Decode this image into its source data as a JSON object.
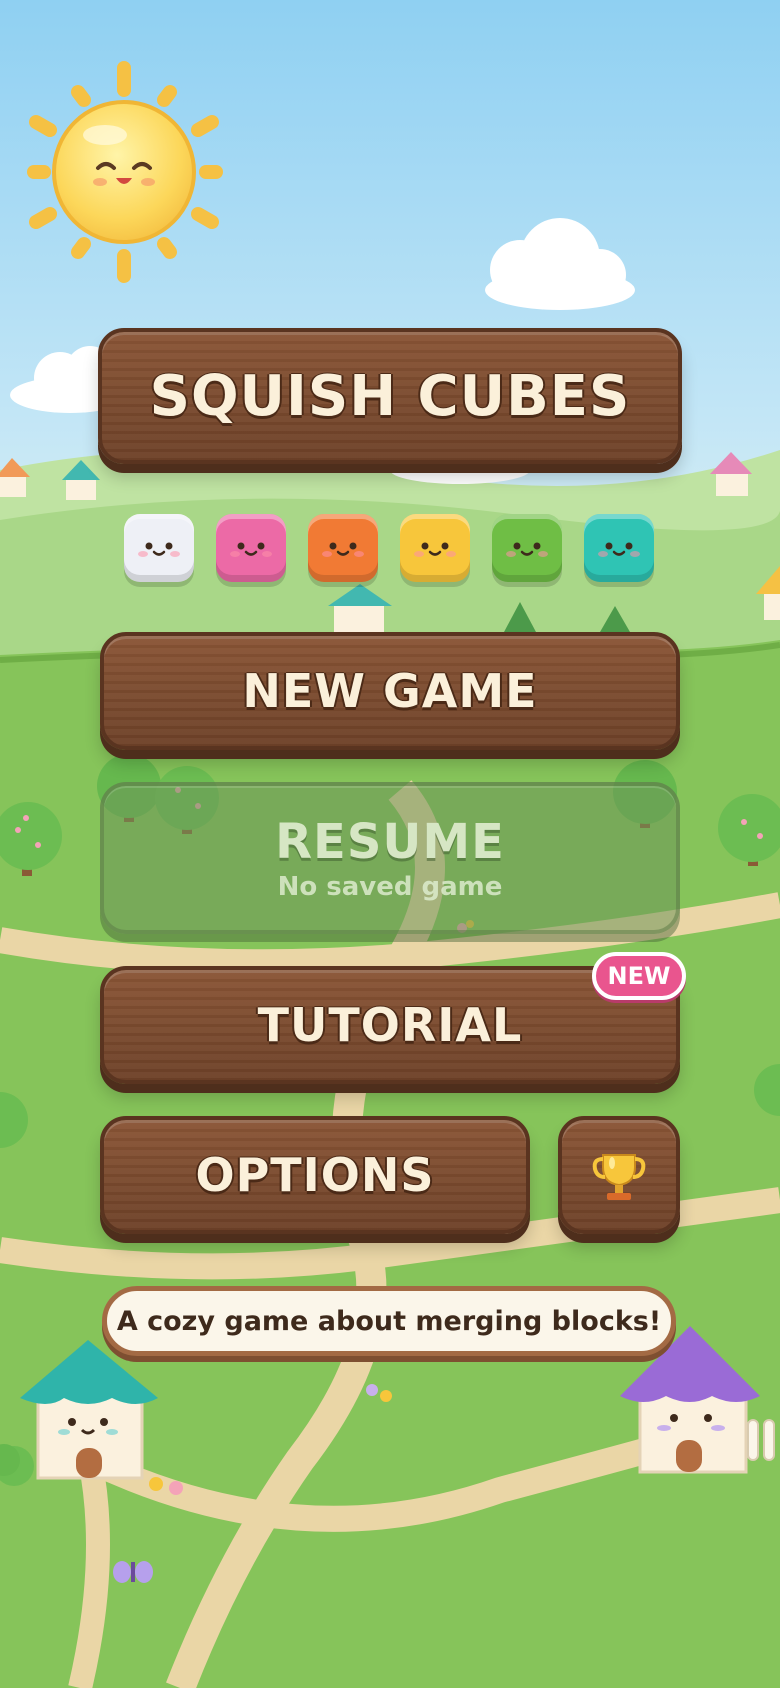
{
  "title": "SQUISH CUBES",
  "menu": {
    "new_game": "NEW GAME",
    "resume": "RESUME",
    "resume_sub": "No saved game",
    "tutorial": "TUTORIAL",
    "tutorial_badge": "NEW",
    "options": "OPTIONS"
  },
  "tagline": "A cozy game about merging blocks!",
  "icons": {
    "achievements": "trophy-icon",
    "sun": "sun-icon"
  },
  "cubes": [
    {
      "name": "white-cube",
      "color": "#eef0f6"
    },
    {
      "name": "pink-cube",
      "color": "#ec6aa6"
    },
    {
      "name": "orange-cube",
      "color": "#f17a34"
    },
    {
      "name": "yellow-cube",
      "color": "#f7c63b"
    },
    {
      "name": "green-cube",
      "color": "#6fbe45"
    },
    {
      "name": "teal-cube",
      "color": "#2fc4b4"
    }
  ],
  "colors": {
    "sky_top": "#8fd0f2",
    "grass": "#86c45a",
    "wood": "#7a4a2e",
    "badge": "#e9558e"
  }
}
